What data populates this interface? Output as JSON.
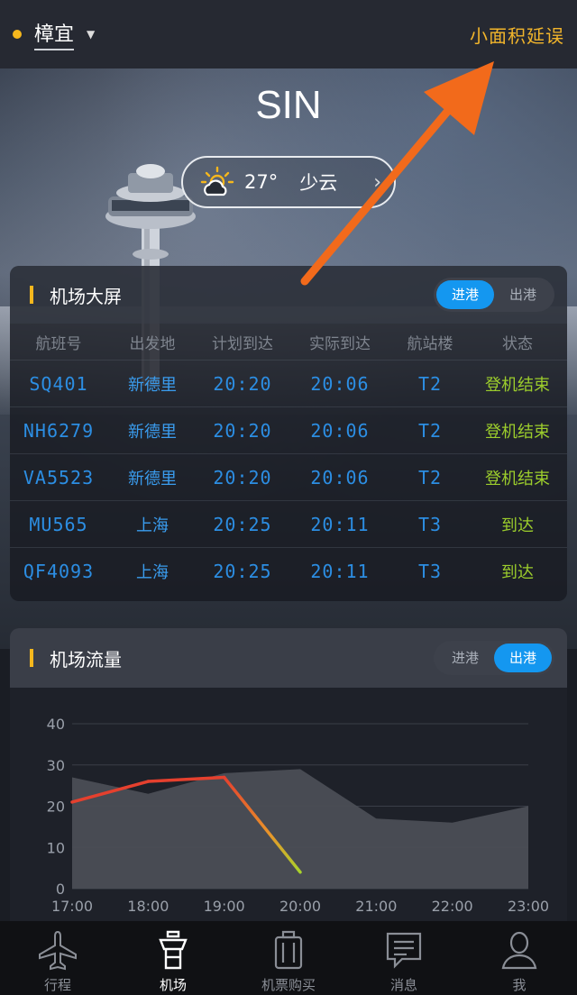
{
  "header": {
    "city": "樟宜",
    "delay_link": "小面积延误"
  },
  "airport": {
    "code": "SIN",
    "weather": {
      "temp": "27°",
      "condition": "少云",
      "icon": "partly-cloudy-icon"
    }
  },
  "board": {
    "title": "机场大屏",
    "toggle": {
      "arrive": "进港",
      "depart": "出港",
      "selected": "arrive"
    },
    "columns": [
      "航班号",
      "出发地",
      "计划到达",
      "实际到达",
      "航站楼",
      "状态"
    ],
    "rows": [
      {
        "flight": "SQ401",
        "origin": "新德里",
        "scheduled": "20:20",
        "actual": "20:06",
        "terminal": "T2",
        "status": "登机结束"
      },
      {
        "flight": "NH6279",
        "origin": "新德里",
        "scheduled": "20:20",
        "actual": "20:06",
        "terminal": "T2",
        "status": "登机结束"
      },
      {
        "flight": "VA5523",
        "origin": "新德里",
        "scheduled": "20:20",
        "actual": "20:06",
        "terminal": "T2",
        "status": "登机结束"
      },
      {
        "flight": "MU565",
        "origin": "上海",
        "scheduled": "20:25",
        "actual": "20:11",
        "terminal": "T3",
        "status": "到达"
      },
      {
        "flight": "QF4093",
        "origin": "上海",
        "scheduled": "20:25",
        "actual": "20:11",
        "terminal": "T3",
        "status": "到达"
      }
    ],
    "colors": {
      "flight_text": "#2c8ee3",
      "status_text": "#9ccd2c"
    }
  },
  "flow": {
    "title": "机场流量",
    "toggle": {
      "arrive": "进港",
      "depart": "出港",
      "selected": "depart"
    }
  },
  "chart_data": {
    "type": "area",
    "x": [
      "17:00",
      "18:00",
      "19:00",
      "20:00",
      "21:00",
      "22:00",
      "23:00"
    ],
    "ylim": [
      0,
      40
    ],
    "yticks": [
      0,
      10,
      20,
      30,
      40
    ],
    "grid": true,
    "series": [
      {
        "kind": "area",
        "x": [
          17.0,
          18.0,
          19.0,
          20.0,
          21.0,
          22.0,
          23.0
        ],
        "values": [
          27,
          23,
          28,
          29,
          17,
          16,
          20
        ]
      },
      {
        "kind": "line",
        "x": [
          17.0,
          18.0,
          19.0,
          20.0
        ],
        "values": [
          21,
          26,
          27,
          4
        ]
      }
    ]
  },
  "tabbar": {
    "items": [
      {
        "label": "行程",
        "icon": "airplane-icon"
      },
      {
        "label": "机场",
        "icon": "control-tower-icon"
      },
      {
        "label": "机票购买",
        "icon": "luggage-icon"
      },
      {
        "label": "消息",
        "icon": "message-icon"
      },
      {
        "label": "我",
        "icon": "user-icon"
      }
    ],
    "active": "机场"
  },
  "theme": {
    "accent": "#f5b71d",
    "toggle_on": "#1497f0",
    "delay": "#f2b52b"
  }
}
